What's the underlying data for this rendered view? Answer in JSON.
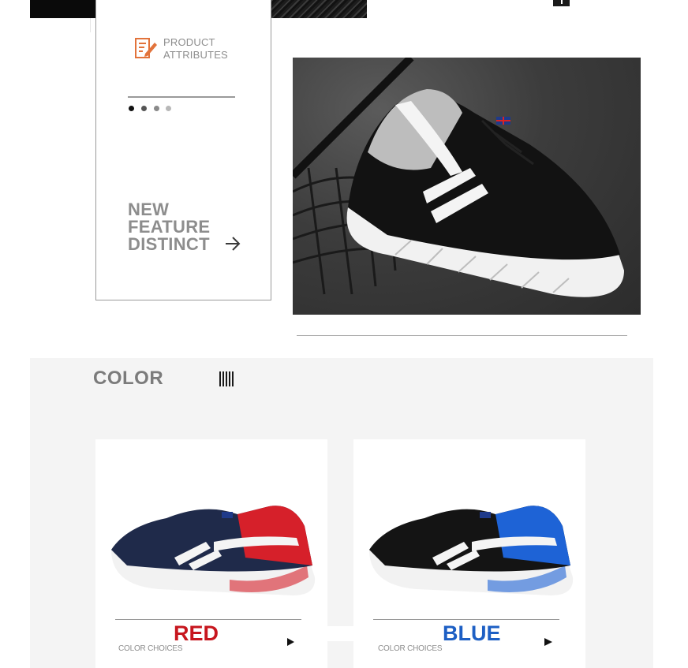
{
  "attributes": {
    "title_line1": "PRODUCT",
    "title_line2": "ATTRIBUTES",
    "feature_line1": "NEW",
    "feature_line2": "FEATURE",
    "feature_line3": "DISTINCT",
    "icon": "edit-document-icon",
    "arrow_icon": "arrow-right-icon",
    "dots": 4
  },
  "color_section": {
    "title": "COLOR",
    "cards": [
      {
        "name": "RED",
        "subtitle": "COLOR CHOICES",
        "name_color": "#c7161e",
        "accent": "#d6202a"
      },
      {
        "name": "BLUE",
        "subtitle": "COLOR CHOICES",
        "name_color": "#1d5fc4",
        "accent": "#1e63d6"
      }
    ]
  },
  "colors": {
    "icon_orange": "#e2733b",
    "text_gray": "#8d8d8d",
    "dark": "#0a0a0a"
  }
}
